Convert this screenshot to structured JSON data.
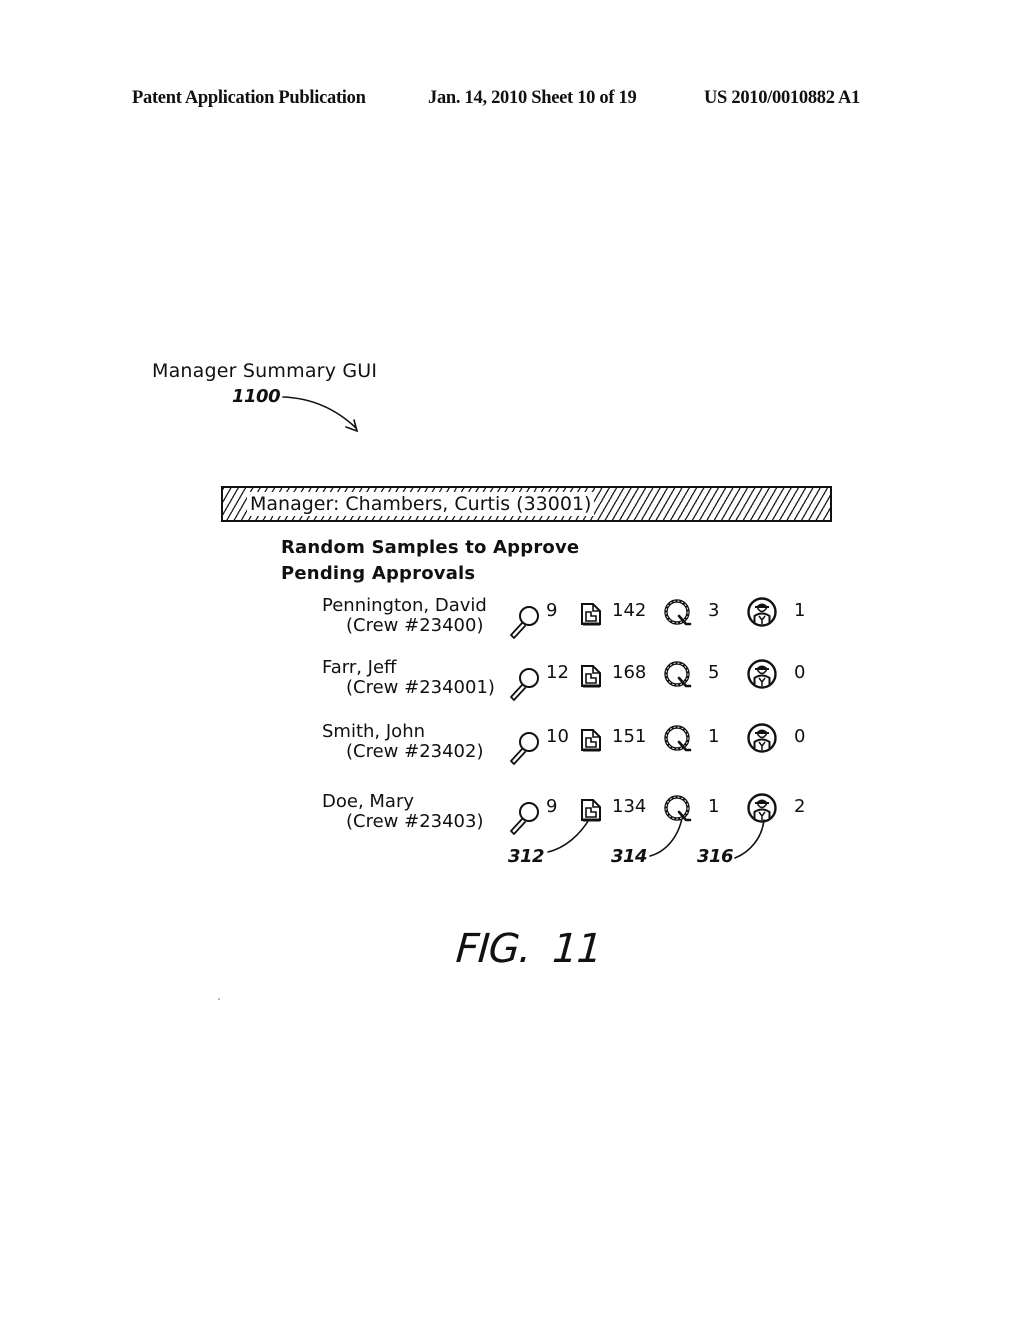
{
  "header": {
    "publication": "Patent Application Publication",
    "date_sheet": "Jan. 14, 2010  Sheet 10 of 19",
    "patent_number": "US 2010/0010882 A1"
  },
  "figure": {
    "gui_label": "Manager Summary GUI",
    "gui_ref": "1100",
    "caption_prefix": "FIG.",
    "caption_number": "11"
  },
  "manager_bar": {
    "label": "Manager: Chambers, Curtis (33001)"
  },
  "sections": {
    "random_samples": "Random Samples to Approve",
    "pending_approvals": "Pending Approvals"
  },
  "icons": {
    "samples": "magnifier-icon",
    "documents": "document-icon",
    "quality": "q-badge-icon",
    "personnel": "worker-badge-icon"
  },
  "crews": [
    {
      "name": "Pennington, David",
      "crew": "(Crew #23400)",
      "samples": "9",
      "documents": "142",
      "quality": "3",
      "personnel": "1"
    },
    {
      "name": "Farr, Jeff",
      "crew": "(Crew #234001)",
      "samples": "12",
      "documents": "168",
      "quality": "5",
      "personnel": "0"
    },
    {
      "name": "Smith, John",
      "crew": "(Crew #23402)",
      "samples": "10",
      "documents": "151",
      "quality": "1",
      "personnel": "0"
    },
    {
      "name": "Doe, Mary",
      "crew": "(Crew #23403)",
      "samples": "9",
      "documents": "134",
      "quality": "1",
      "personnel": "2"
    }
  ],
  "reference_numerals": {
    "document_icon": "312",
    "q_icon": "314",
    "worker_icon": "316"
  }
}
